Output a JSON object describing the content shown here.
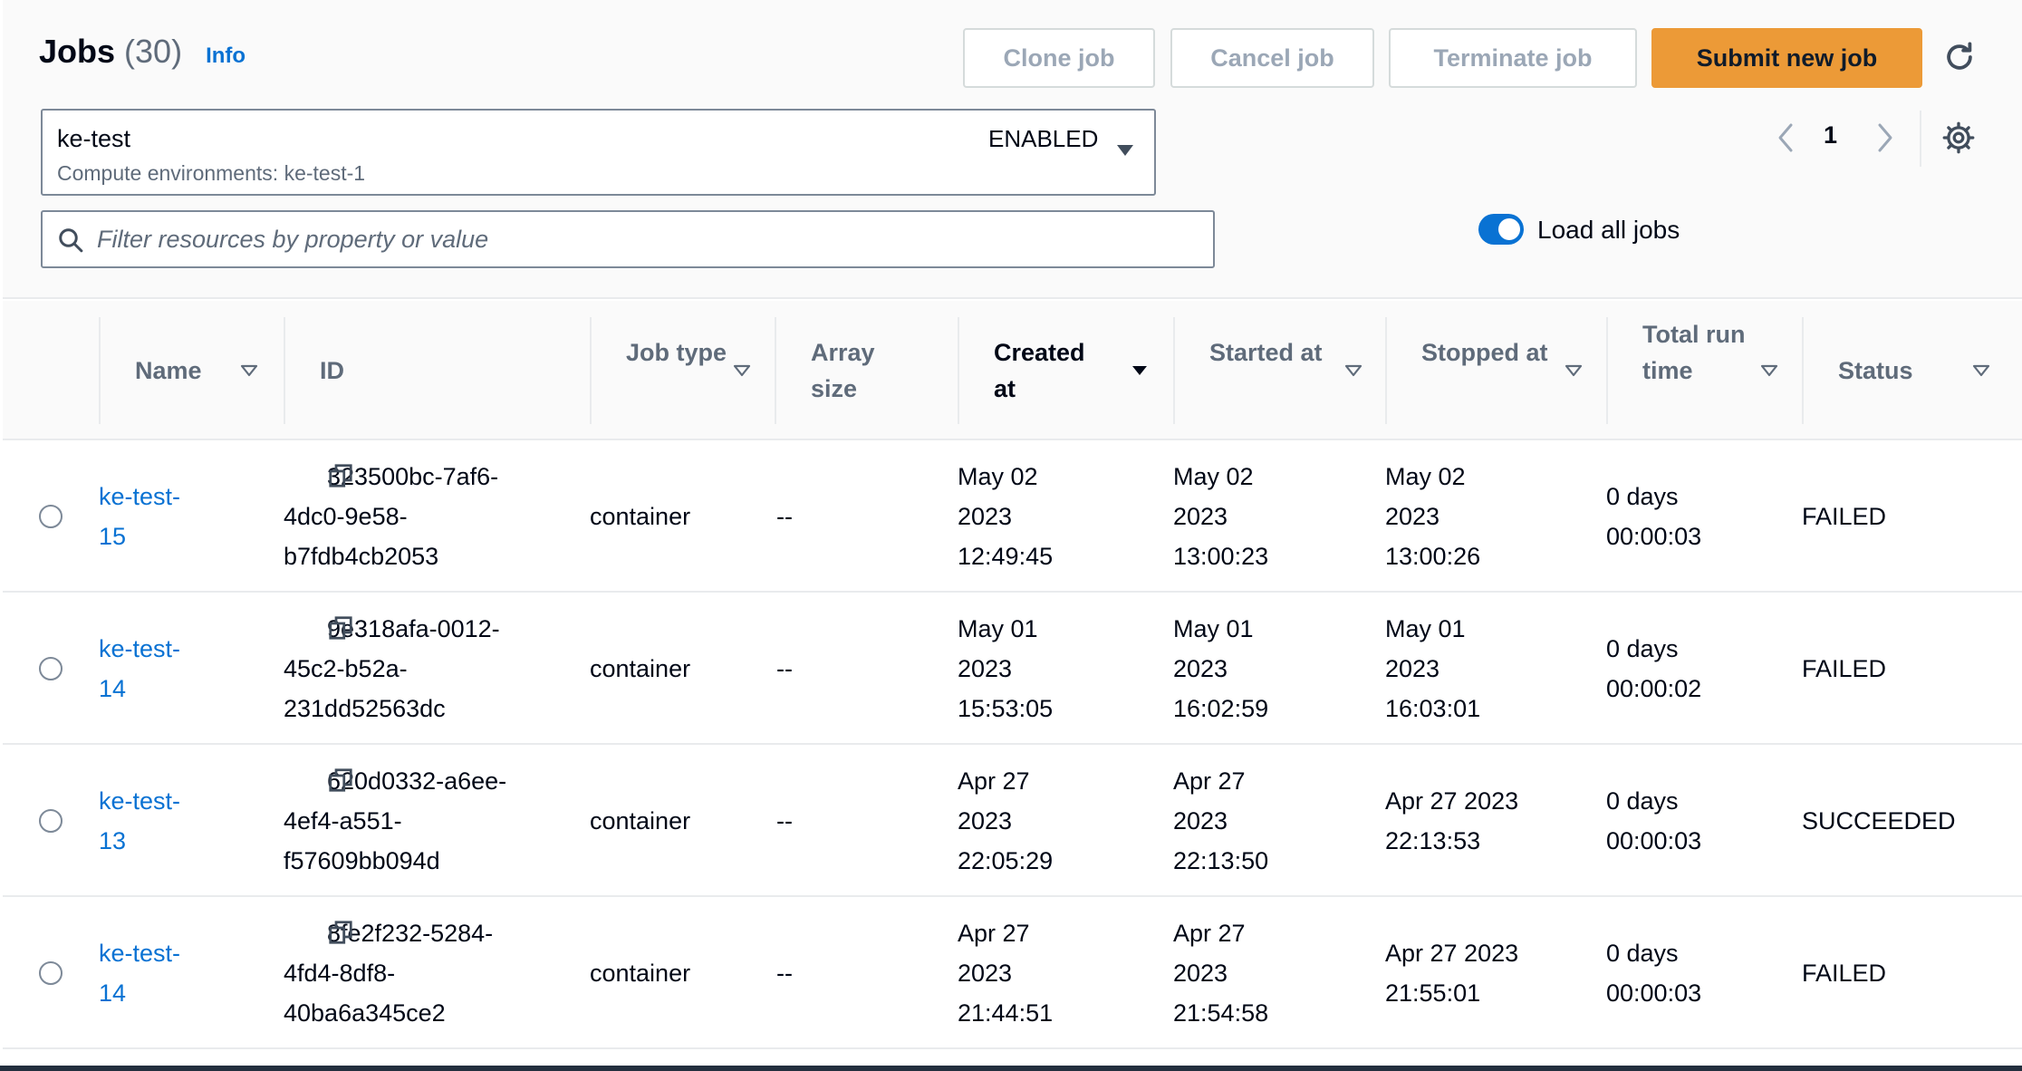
{
  "header": {
    "title": "Jobs",
    "count": "(30)",
    "info_label": "Info",
    "buttons": {
      "clone": "Clone job",
      "cancel": "Cancel job",
      "terminate": "Terminate job",
      "submit": "Submit new job"
    }
  },
  "queue": {
    "name": "ke-test",
    "compute_env": "Compute environments: ke-test-1",
    "state": "ENABLED"
  },
  "pagination": {
    "current_page": "1"
  },
  "search": {
    "placeholder": "Filter resources by property or value",
    "value": ""
  },
  "toggle": {
    "label": "Load all jobs",
    "checked": true
  },
  "table": {
    "columns": [
      {
        "key": "name",
        "label": "Name"
      },
      {
        "key": "id",
        "label": "ID"
      },
      {
        "key": "job_type",
        "label": "Job type"
      },
      {
        "key": "array_size",
        "label": "Array size"
      },
      {
        "key": "created_at",
        "label": "Created at",
        "sorted": "descending"
      },
      {
        "key": "started_at",
        "label": "Started at"
      },
      {
        "key": "stopped_at",
        "label": "Stopped at"
      },
      {
        "key": "total_run_time",
        "label": "Total run time"
      },
      {
        "key": "status",
        "label": "Status"
      }
    ],
    "rows": [
      {
        "name": "ke-test-15",
        "id": "323500bc-7af6-4dc0-9e58-b7fdb4cb2053",
        "job_type": "container",
        "array_size": "--",
        "created_at": "May 02 2023 12:49:45",
        "started_at": "May 02 2023 13:00:23",
        "stopped_at": "May 02 2023 13:00:26",
        "total_run_time": "0 days 00:00:03",
        "status": "FAILED"
      },
      {
        "name": "ke-test-14",
        "id": "9e318afa-0012-45c2-b52a-231dd52563dc",
        "job_type": "container",
        "array_size": "--",
        "created_at": "May 01 2023 15:53:05",
        "started_at": "May 01 2023 16:02:59",
        "stopped_at": "May 01 2023 16:03:01",
        "total_run_time": "0 days 00:00:02",
        "status": "FAILED"
      },
      {
        "name": "ke-test-13",
        "id": "620d0332-a6ee-4ef4-a551-f57609bb094d",
        "job_type": "container",
        "array_size": "--",
        "created_at": "Apr 27 2023 22:05:29",
        "started_at": "Apr 27 2023 22:13:50",
        "stopped_at": "Apr 27 2023 22:13:53",
        "total_run_time": "0 days 00:00:03",
        "status": "SUCCEEDED"
      },
      {
        "name": "ke-test-14",
        "id": "8fe2f232-5284-4fd4-8df8-40ba6a345ce2",
        "job_type": "container",
        "array_size": "--",
        "created_at": "Apr 27 2023 21:44:51",
        "started_at": "Apr 27 2023 21:54:58",
        "stopped_at": "Apr 27 2023 21:55:01",
        "total_run_time": "0 days 00:00:03",
        "status": "FAILED"
      }
    ]
  },
  "colors": {
    "accent": "#0972d3",
    "primary_button": "#ec9a37",
    "text": "#000716",
    "muted": "#5f6b7a"
  }
}
